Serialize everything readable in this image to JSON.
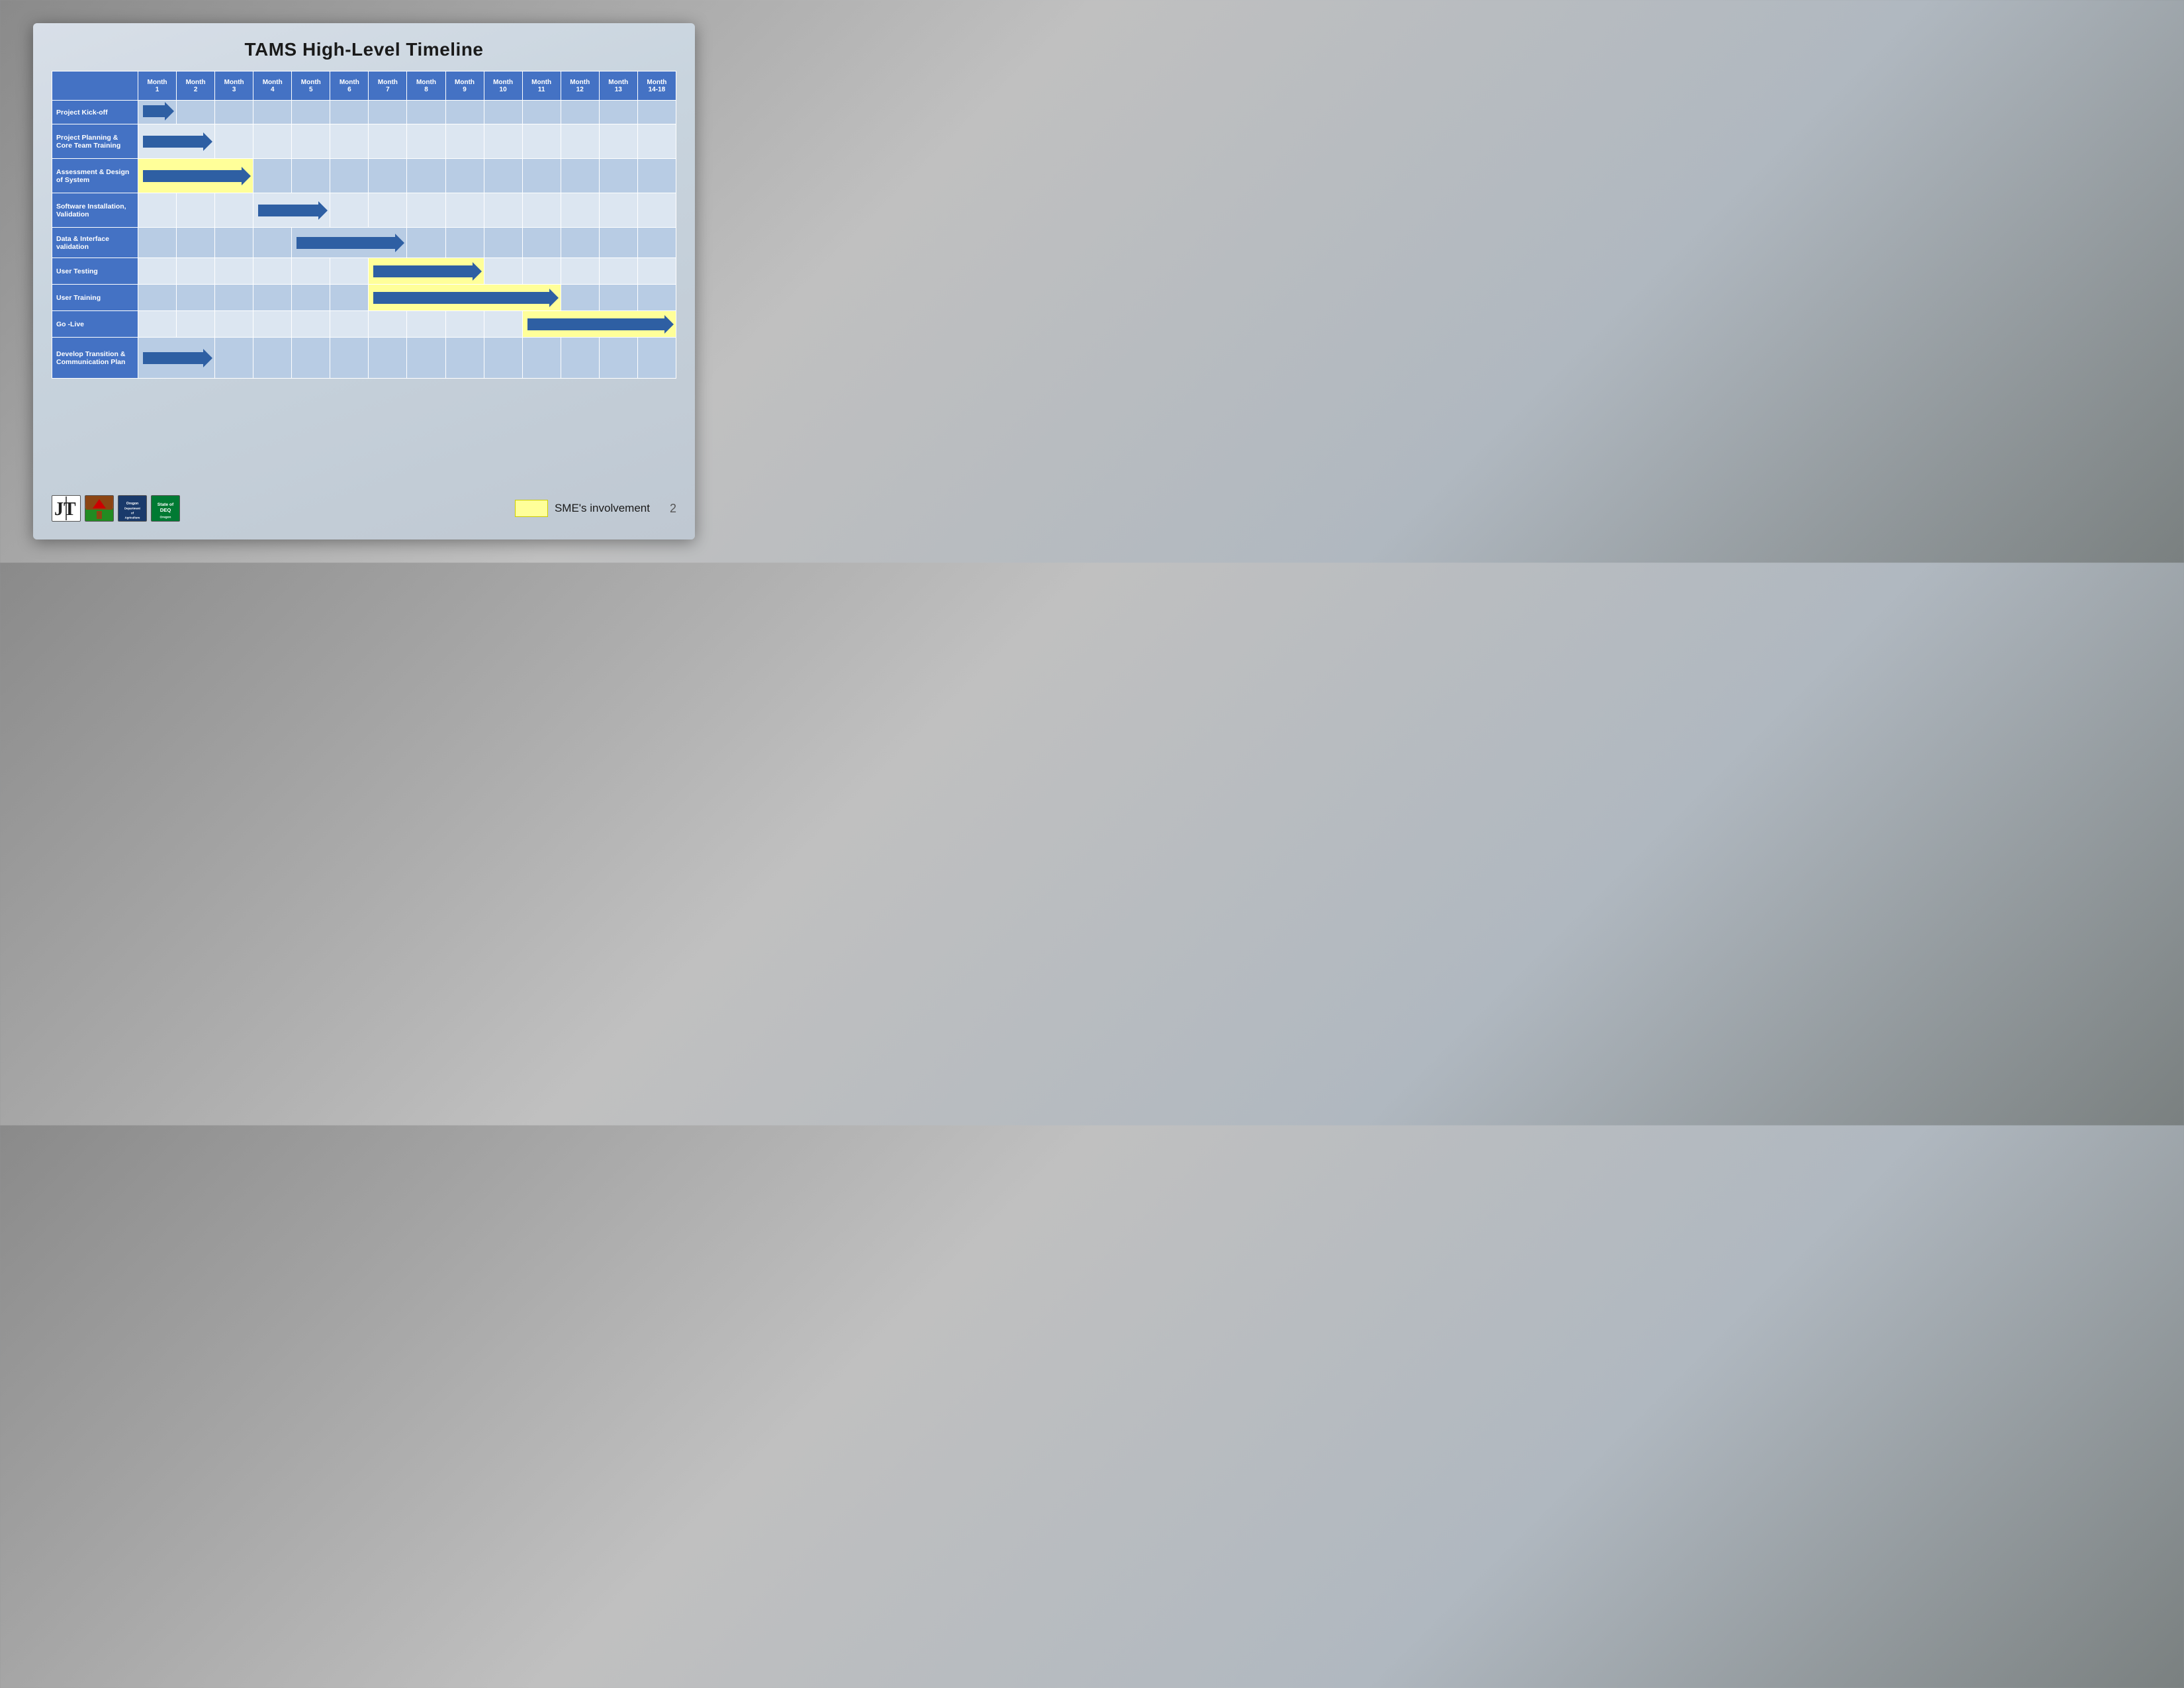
{
  "slide": {
    "title": "TAMS High-Level Timeline",
    "months": [
      {
        "label": "Month",
        "sub": "1"
      },
      {
        "label": "Month",
        "sub": "2"
      },
      {
        "label": "Month",
        "sub": "3"
      },
      {
        "label": "Month",
        "sub": "4"
      },
      {
        "label": "Month",
        "sub": "5"
      },
      {
        "label": "Month",
        "sub": "6"
      },
      {
        "label": "Month",
        "sub": "7"
      },
      {
        "label": "Month",
        "sub": "8"
      },
      {
        "label": "Month",
        "sub": "9"
      },
      {
        "label": "Month",
        "sub": "10"
      },
      {
        "label": "Month",
        "sub": "11"
      },
      {
        "label": "Month",
        "sub": "12"
      },
      {
        "label": "Month",
        "sub": "13"
      },
      {
        "label": "Month",
        "sub": "14-18"
      }
    ],
    "tasks": [
      {
        "name": "Project Kick-off",
        "arrow_start": 1,
        "arrow_end": 1,
        "yellow": false
      },
      {
        "name": "Project Planning & Core Team Training",
        "arrow_start": 1,
        "arrow_end": 2,
        "yellow": false
      },
      {
        "name": "Assessment & Design of System",
        "arrow_start": 1,
        "arrow_end": 3,
        "yellow": true
      },
      {
        "name": "Software Installation, Validation",
        "arrow_start": 4,
        "arrow_end": 5,
        "yellow": false
      },
      {
        "name": "Data & Interface validation",
        "arrow_start": 5,
        "arrow_end": 7,
        "yellow": false
      },
      {
        "name": "User Testing",
        "arrow_start": 7,
        "arrow_end": 9,
        "yellow": true
      },
      {
        "name": "User Training",
        "arrow_start": 7,
        "arrow_end": 11,
        "yellow": true
      },
      {
        "name": "Go -Live",
        "arrow_start": 11,
        "arrow_end": 14,
        "yellow": true
      },
      {
        "name": "Develop Transition & Communication Plan",
        "arrow_start": 1,
        "arrow_end": 2,
        "yellow": false
      }
    ],
    "legend": {
      "label": "SME's involvement"
    },
    "page_number": "2"
  }
}
